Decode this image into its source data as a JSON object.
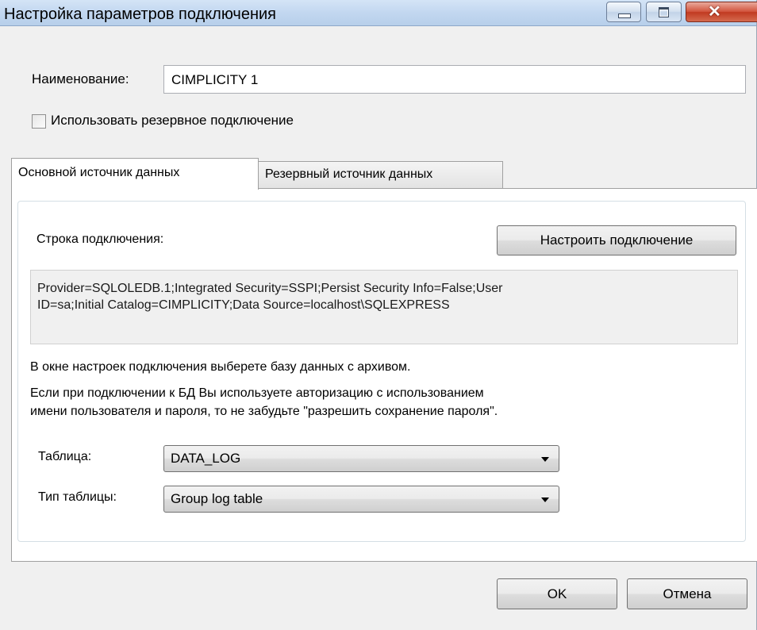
{
  "window": {
    "title": "Настройка параметров подключения",
    "controls": {
      "minimize": "minimize",
      "maximize": "maximize",
      "close": "close"
    }
  },
  "form": {
    "name_label": "Наименование:",
    "name_value": "CIMPLICITY 1",
    "backup_checkbox_label": "Использовать резервное подключение",
    "backup_checked": false
  },
  "tabs": [
    {
      "label": "Основной источник данных",
      "active": true
    },
    {
      "label": "Резервный источник данных",
      "active": false
    }
  ],
  "panel": {
    "connection_string_label": "Строка подключения:",
    "configure_button": "Настроить подключение",
    "connection_string_lines": [
      "Provider=SQLOLEDB.1;Integrated Security=SSPI;Persist Security Info=False;User",
      "ID=sa;Initial Catalog=CIMPLICITY;Data Source=localhost\\SQLEXPRESS"
    ],
    "hint_1": "В окне настроек подключения выберете базу данных с архивом.",
    "hint_2_line_1": "Если при подключении к БД Вы используете авторизацию с использованием",
    "hint_2_line_2": "имени пользователя и пароля, то не забудьте \"разрешить сохранение пароля\".",
    "table_label": "Таблица:",
    "table_value": "DATA_LOG",
    "table_type_label": "Тип таблицы:",
    "table_type_value": "Group log table"
  },
  "footer": {
    "ok_button": "OK",
    "cancel_button": "Отмена"
  },
  "colors": {
    "titlebar": "#c2d7f0",
    "close_button": "#c13a21",
    "window_bg": "#f0f0f0"
  }
}
